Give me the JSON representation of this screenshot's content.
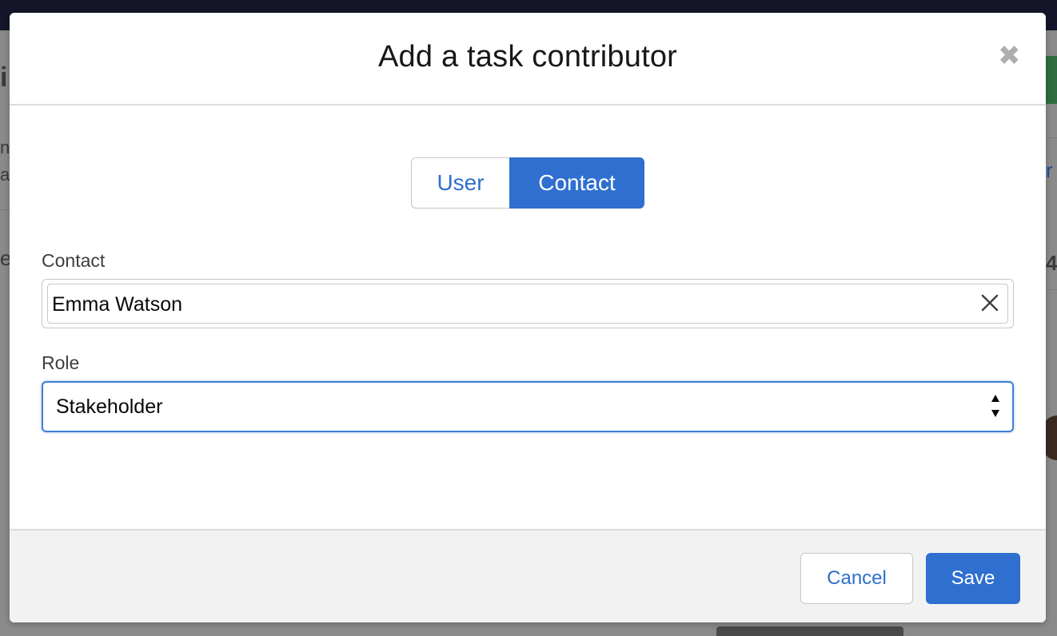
{
  "background": {
    "fragments": [
      "i",
      "nt",
      "a",
      "e",
      "r",
      "4"
    ]
  },
  "modal": {
    "title": "Add a task contributor",
    "close_symbol": "✖",
    "toggle": {
      "options": [
        {
          "label": "User",
          "selected": false
        },
        {
          "label": "Contact",
          "selected": true
        }
      ]
    },
    "contact_field": {
      "label": "Contact",
      "value": "Emma Watson",
      "clear_icon": "close-x-icon"
    },
    "role_field": {
      "label": "Role",
      "value": "Stakeholder",
      "arrow_icon": "up-down-arrows-icon"
    },
    "footer": {
      "cancel_label": "Cancel",
      "save_label": "Save"
    }
  },
  "colors": {
    "brand_blue": "#2f6fd0",
    "link_blue": "#2f6fc8",
    "border": "#c9c7c5",
    "footer_bg": "#f3f2f2",
    "topbar": "#16162a"
  }
}
